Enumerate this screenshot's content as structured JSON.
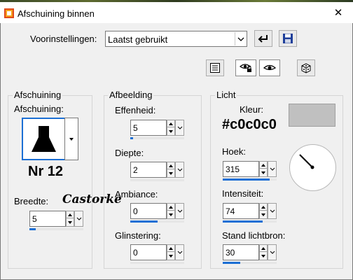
{
  "window": {
    "title": "Afschuining binnen",
    "close_glyph": "✕"
  },
  "presets": {
    "label": "Voorinstellingen:",
    "value": "Laatst gebruikt",
    "icons": [
      "reset-arrow-icon",
      "save-disk-icon"
    ]
  },
  "toolbar": {
    "icons": [
      "list-view-icon",
      "eye-lock-icon",
      "eye-icon",
      "dice-icon"
    ]
  },
  "bevel": {
    "group_label": "Afschuining",
    "shape_label": "Afschuining:",
    "preset_name": "Nr 12",
    "width": {
      "label": "Breedte:",
      "value": "5",
      "level": 0.12
    }
  },
  "watermark": {
    "text": "Castorke"
  },
  "image": {
    "group_label": "Afbeelding",
    "smoothness": {
      "label": "Effenheid:",
      "value": "5",
      "level": 0.05
    },
    "depth": {
      "label": "Diepte:",
      "value": "2",
      "level": 0.0
    },
    "ambiance": {
      "label": "Ambiance:",
      "value": "0",
      "level": 0.5
    },
    "shininess": {
      "label": "Glinstering:",
      "value": "0",
      "level": 0.0
    }
  },
  "light": {
    "group_label": "Licht",
    "color_label": "Kleur:",
    "color_hex": "#c0c0c0",
    "angle": {
      "label": "Hoek:",
      "value": "315",
      "level": 0.875
    },
    "intensity": {
      "label": "Intensiteit:",
      "value": "74",
      "level": 0.74
    },
    "elevation": {
      "label": "Stand lichtbron:",
      "value": "30",
      "level": 0.33
    }
  },
  "colors": {
    "accent": "#1c6fd4",
    "swatch": "#c0c0c0"
  }
}
